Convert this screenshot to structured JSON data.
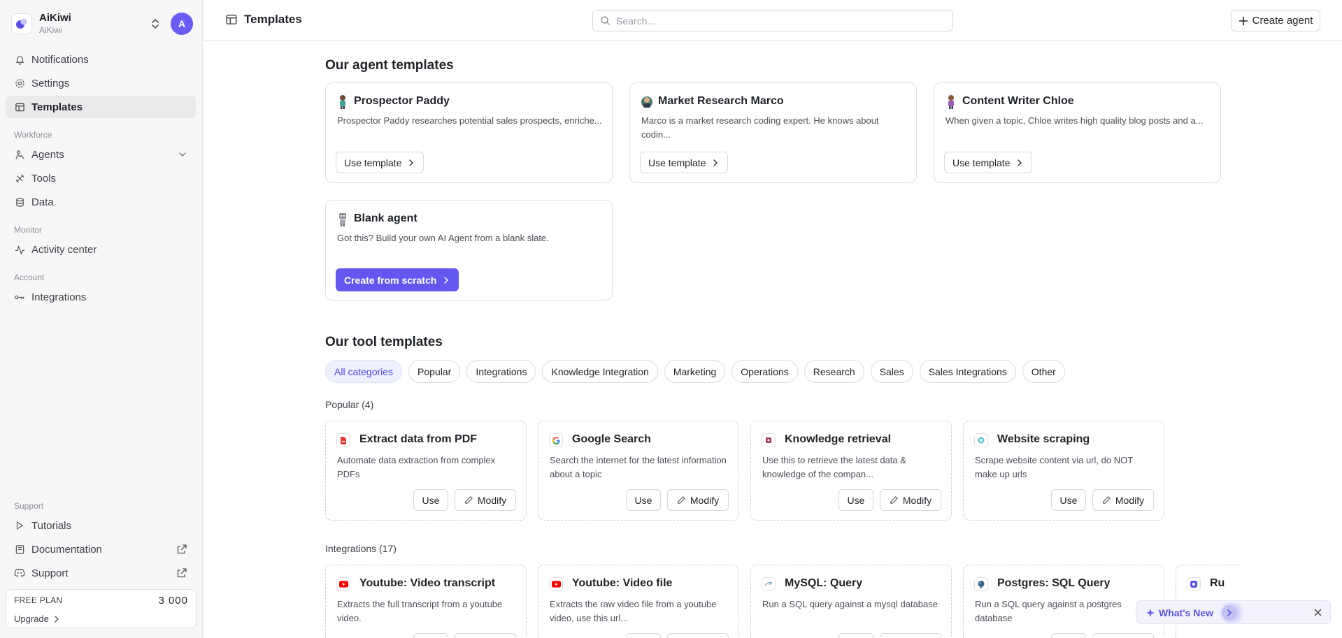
{
  "workspace": {
    "name": "AiKiwi",
    "sub": "AiKiwi",
    "avatar": "A"
  },
  "sidebar": {
    "top_items": [
      {
        "label": "Notifications",
        "icon": "bell-icon"
      },
      {
        "label": "Settings",
        "icon": "gear-icon"
      },
      {
        "label": "Templates",
        "icon": "templates-icon"
      }
    ],
    "sections": [
      {
        "label": "Workforce",
        "items": [
          {
            "label": "Agents"
          },
          {
            "label": "Tools"
          },
          {
            "label": "Data"
          }
        ]
      },
      {
        "label": "Monitor",
        "items": [
          {
            "label": "Activity center"
          }
        ]
      },
      {
        "label": "Account",
        "items": [
          {
            "label": "Integrations"
          }
        ]
      },
      {
        "label": "Support",
        "items": [
          {
            "label": "Tutorials"
          },
          {
            "label": "Documentation"
          },
          {
            "label": "Support"
          }
        ]
      }
    ],
    "plan": {
      "label": "FREE PLAN",
      "credits": "3 000",
      "upgrade": "Upgrade"
    }
  },
  "header": {
    "title": "Templates",
    "search_placeholder": "Search...",
    "create_label": "Create agent"
  },
  "agents": {
    "heading": "Our agent templates",
    "cards": [
      {
        "title": "Prospector Paddy",
        "desc": "Prospector Paddy researches potential sales prospects, enriche...",
        "button": "Use template"
      },
      {
        "title": "Market Research Marco",
        "desc": "Marco is a market research coding expert. He knows about codin...",
        "button": "Use template"
      },
      {
        "title": "Content Writer Chloe",
        "desc": "When given a topic, Chloe writes high quality blog posts and a...",
        "button": "Use template"
      },
      {
        "title": "Blank agent",
        "desc": "Got this? Build your own AI Agent from a blank slate.",
        "button": "Create from scratch"
      }
    ]
  },
  "tools": {
    "heading": "Our tool templates",
    "categories": [
      "All categories",
      "Popular",
      "Integrations",
      "Knowledge Integration",
      "Marketing",
      "Operations",
      "Research",
      "Sales",
      "Sales Integrations",
      "Other"
    ],
    "popular": {
      "label": "Popular (4)",
      "cards": [
        {
          "title": "Extract data from PDF",
          "desc": "Automate data extraction from complex PDFs",
          "icon": "pdf-icon"
        },
        {
          "title": "Google Search",
          "desc": "Search the internet for the latest information about a topic",
          "icon": "google-icon"
        },
        {
          "title": "Knowledge retrieval",
          "desc": "Use this to retrieve the latest data & knowledge of the compan...",
          "icon": "knowledge-icon"
        },
        {
          "title": "Website scraping",
          "desc": "Scrape website content via url, do NOT make up urls",
          "icon": "scraper-icon"
        }
      ]
    },
    "integrations": {
      "label": "Integrations (17)",
      "cards": [
        {
          "title": "Youtube: Video transcript",
          "desc": "Extracts the full transcript from a youtube video.",
          "icon": "youtube-icon"
        },
        {
          "title": "Youtube: Video file",
          "desc": "Extracts the raw video file from a youtube video, use this url...",
          "icon": "youtube-icon"
        },
        {
          "title": "MySQL: Query",
          "desc": "Run a SQL query against a mysql database",
          "icon": "mysql-icon"
        },
        {
          "title": "Postgres: SQL Query",
          "desc": "Run a SQL query against a postgres database",
          "icon": "postgres-icon"
        },
        {
          "title": "Ru",
          "desc": "",
          "icon": "app-icon"
        }
      ]
    },
    "use_label": "Use",
    "modify_label": "Modify"
  },
  "whats_new": {
    "label": "What's New"
  },
  "colors": {
    "accent": "#6457f0",
    "active_pill_text": "#4f46e5"
  }
}
